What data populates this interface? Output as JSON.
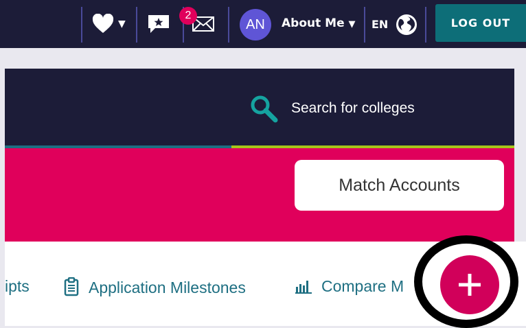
{
  "header": {
    "favorites_icon": "heart-icon",
    "reviews_icon": "star-chat-icon",
    "messages_icon": "envelope-icon",
    "messages_count": "2",
    "avatar_initials": "AN",
    "profile_label": "About Me",
    "language_label": "EN",
    "language_icon": "globe-icon",
    "logout_label": "LOG OUT"
  },
  "search": {
    "label": "Search for colleges",
    "icon": "search-icon"
  },
  "actions": {
    "match_accounts_label": "Match Accounts"
  },
  "tabs": [
    {
      "label": "ipts"
    },
    {
      "label": "Application Milestones",
      "icon": "clipboard-icon"
    },
    {
      "label": "Compare M",
      "icon": "bar-chart-icon"
    }
  ],
  "fab": {
    "icon": "plus-icon",
    "color": "#d1005a"
  }
}
